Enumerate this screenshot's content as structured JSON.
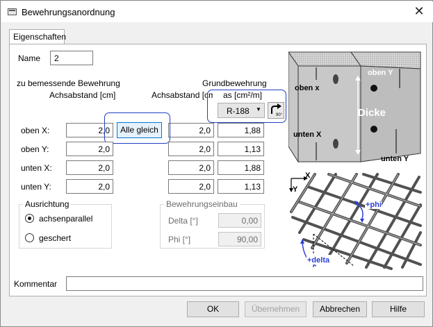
{
  "window": {
    "title": "Bewehrungsanordnung"
  },
  "tab": {
    "label": "Eigenschaften"
  },
  "name": {
    "label": "Name",
    "value": "2"
  },
  "headers": {
    "zu_bemessende": "zu bemessende Bewehrung",
    "achsabstand_left": "Achsabstand [cm]",
    "grundbewehrung": "Grundbewehrung",
    "achsabstand_right": "Achsabstand [cm]",
    "as_unit": "as [cm²/m]"
  },
  "combo": {
    "value": "R-188"
  },
  "alle_gleich": "Alle gleich",
  "rows": [
    {
      "label": "oben X:",
      "achs": "2,0",
      "grund_achs": "2,0",
      "as": "1,88"
    },
    {
      "label": "oben Y:",
      "achs": "2,0",
      "grund_achs": "2,0",
      "as": "1,13"
    },
    {
      "label": "unten X:",
      "achs": "2,0",
      "grund_achs": "2,0",
      "as": "1,88"
    },
    {
      "label": "unten Y:",
      "achs": "2,0",
      "grund_achs": "2,0",
      "as": "1,13"
    }
  ],
  "ausrichtung": {
    "title": "Ausrichtung",
    "options": [
      "achsenparallel",
      "geschert"
    ],
    "selected": "achsenparallel"
  },
  "einbau": {
    "title": "Bewehrungseinbau",
    "delta_label": "Delta [°]",
    "delta_value": "0,00",
    "phi_label": "Phi [°]",
    "phi_value": "90,00"
  },
  "diagram": {
    "oben_x": "oben x",
    "oben_y": "oben Y",
    "dicke": "Dicke",
    "unten_x": "unten X",
    "unten_y": "unten Y",
    "axis_x": "X",
    "axis_y": "Y",
    "phi": "+phi",
    "delta": "+delta",
    "rotate_label": "90°"
  },
  "kommentar": {
    "label": "Kommentar",
    "value": ""
  },
  "buttons": {
    "ok": "OK",
    "apply": "Übernehmen",
    "cancel": "Abbrechen",
    "help": "Hilfe"
  }
}
